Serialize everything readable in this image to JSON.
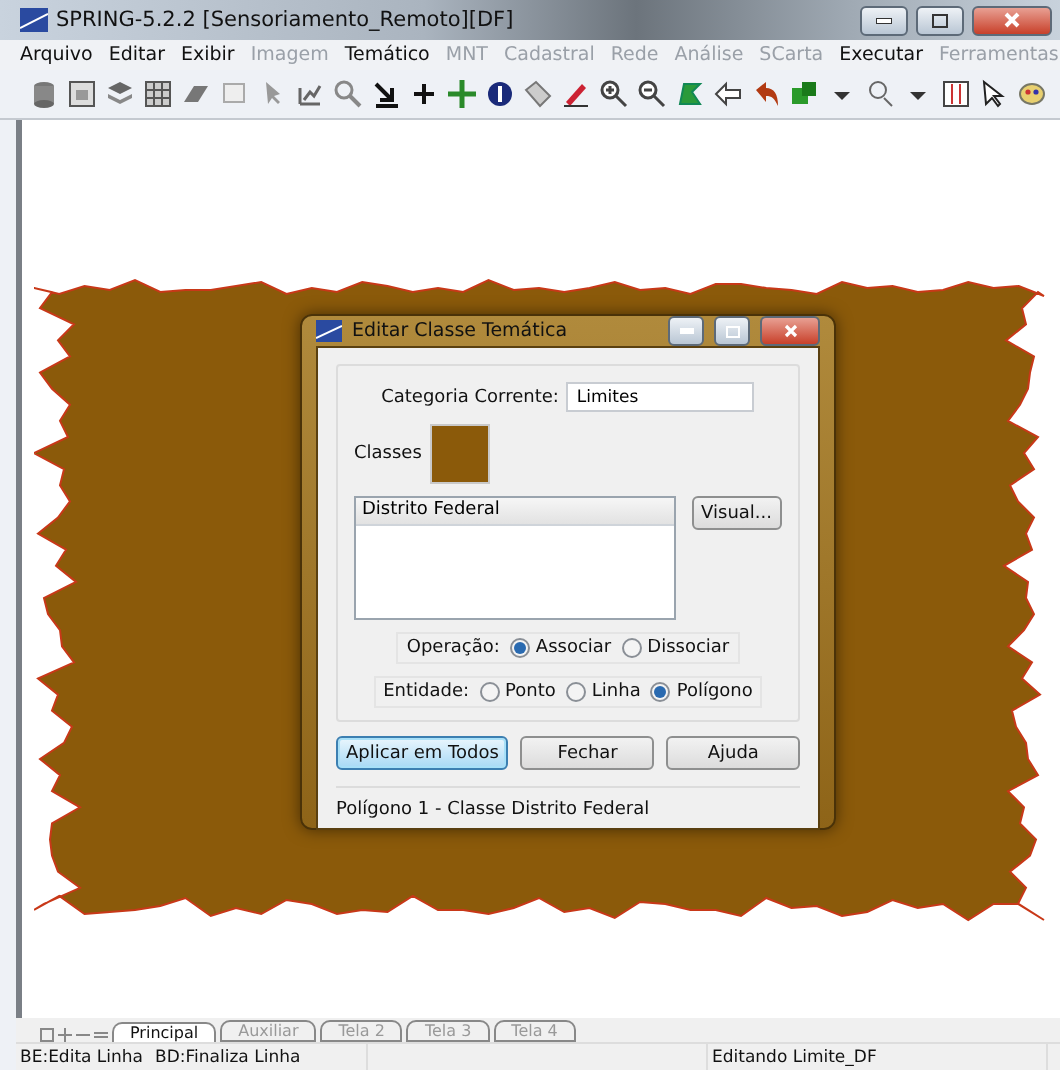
{
  "window": {
    "title": "SPRING-5.2.2 [Sensoriamento_Remoto][DF]"
  },
  "menu": [
    {
      "label": "Arquivo",
      "disabled": false
    },
    {
      "label": "Editar",
      "disabled": false
    },
    {
      "label": "Exibir",
      "disabled": false
    },
    {
      "label": "Imagem",
      "disabled": true
    },
    {
      "label": "Temático",
      "disabled": false
    },
    {
      "label": "MNT",
      "disabled": true
    },
    {
      "label": "Cadastral",
      "disabled": true
    },
    {
      "label": "Rede",
      "disabled": true
    },
    {
      "label": "Análise",
      "disabled": true
    },
    {
      "label": "SCarta",
      "disabled": true
    },
    {
      "label": "Executar",
      "disabled": false
    },
    {
      "label": "Ferramentas",
      "disabled": true
    }
  ],
  "dialog": {
    "title": "Editar Classe Temática",
    "category_label": "Categoria Corrente:",
    "category_value": "Limites",
    "classes_label": "Classes",
    "classes": [
      {
        "label": "Distrito Federal",
        "selected": true,
        "color": "#8b5a0a"
      }
    ],
    "visual_button": "Visual...",
    "operation": {
      "label": "Operação:",
      "options": [
        {
          "label": "Associar",
          "selected": true
        },
        {
          "label": "Dissociar",
          "selected": false
        }
      ]
    },
    "entity": {
      "label": "Entidade:",
      "options": [
        {
          "label": "Ponto",
          "selected": false
        },
        {
          "label": "Linha",
          "selected": false
        },
        {
          "label": "Polígono",
          "selected": true
        }
      ]
    },
    "buttons": [
      {
        "label": "Aplicar em Todos",
        "focused": true
      },
      {
        "label": "Fechar",
        "focused": false
      },
      {
        "label": "Ajuda",
        "focused": false
      }
    ],
    "status": "Polígono 1 - Classe Distrito Federal"
  },
  "view_tabs": [
    {
      "label": "Principal",
      "selected": true
    },
    {
      "label": "Auxiliar",
      "selected": false
    },
    {
      "label": "Tela 2",
      "selected": false
    },
    {
      "label": "Tela 3",
      "selected": false
    },
    {
      "label": "Tela 4",
      "selected": false
    }
  ],
  "status_bar": [
    "BE:Edita Linha",
    "BD:Finaliza Linha",
    "Editando Limite_DF"
  ]
}
